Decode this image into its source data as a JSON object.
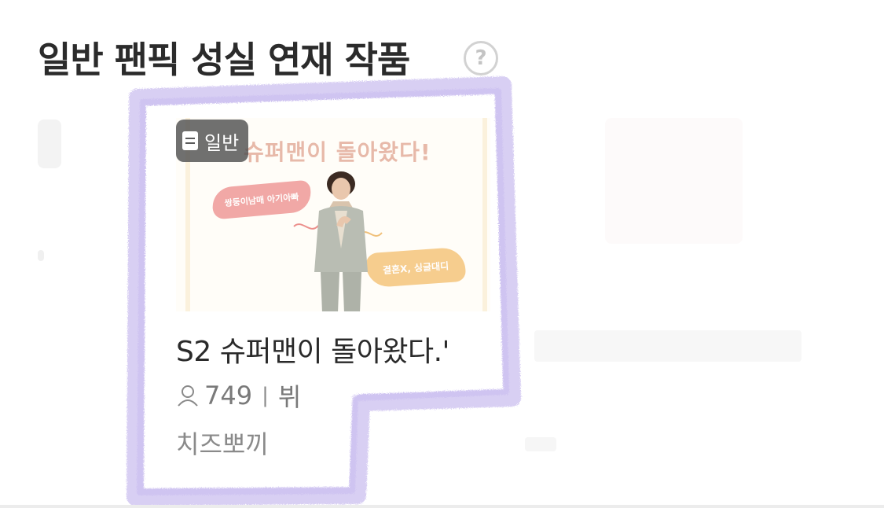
{
  "section": {
    "title": "일반 팬픽 성실 연재 작품",
    "help_icon": "question-circle-icon",
    "help_label": "?"
  },
  "card": {
    "badge_icon": "document-icon",
    "badge_label": "일반",
    "thumbnail": {
      "title": "슈퍼맨이 돌아왔다!",
      "tag_left": "쌍둥이남매 아기아빠",
      "tag_right": "결혼X, 싱글대디"
    },
    "title": "S2 슈퍼맨이 돌아왔다.'",
    "view_icon": "person-icon",
    "views": "749",
    "separator": "|",
    "genre": "뷔",
    "author": "치즈뽀끼"
  },
  "colors": {
    "highlight": "#b9a8ea",
    "badge_bg": "#505050",
    "tag_pink": "#ef9a98",
    "tag_orange": "#f6c883"
  }
}
